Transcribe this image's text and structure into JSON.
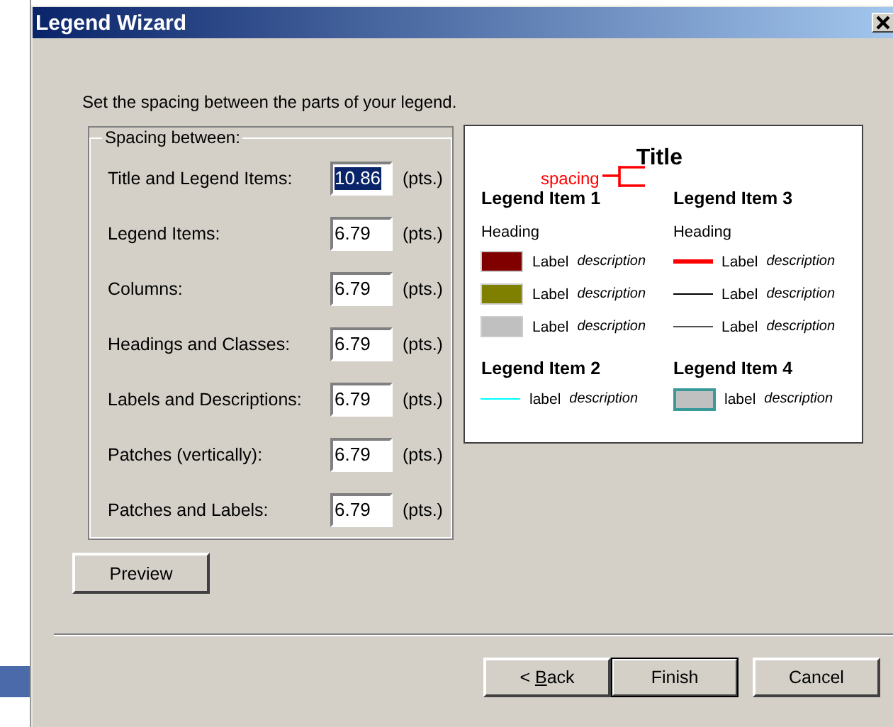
{
  "window": {
    "title": "Legend Wizard"
  },
  "instruction": "Set the spacing between the parts of your legend.",
  "spacing_group": {
    "label": "Spacing between:",
    "rows": [
      {
        "label": "Title and Legend Items:",
        "value": "10.86",
        "unit": "(pts.)",
        "selected": true
      },
      {
        "label": "Legend Items:",
        "value": "6.79",
        "unit": "(pts.)",
        "selected": false
      },
      {
        "label": "Columns:",
        "value": "6.79",
        "unit": "(pts.)",
        "selected": false
      },
      {
        "label": "Headings and Classes:",
        "value": "6.79",
        "unit": "(pts.)",
        "selected": false
      },
      {
        "label": "Labels and Descriptions:",
        "value": "6.79",
        "unit": "(pts.)",
        "selected": false
      },
      {
        "label": "Patches (vertically):",
        "value": "6.79",
        "unit": "(pts.)",
        "selected": false
      },
      {
        "label": "Patches and Labels:",
        "value": "6.79",
        "unit": "(pts.)",
        "selected": false
      }
    ]
  },
  "legend_preview": {
    "title": "Title",
    "spacing_label": "spacing",
    "columns": [
      {
        "items": [
          {
            "heading": "Legend Item 1",
            "subheading": "Heading",
            "entries": [
              {
                "kind": "patch",
                "color": "#800000",
                "label": "Label",
                "description": "description"
              },
              {
                "kind": "patch",
                "color": "#808000",
                "label": "Label",
                "description": "description"
              },
              {
                "kind": "patch",
                "color": "#c0c0c0",
                "label": "Label",
                "description": "description"
              }
            ]
          },
          {
            "heading": "Legend Item 2",
            "entries": [
              {
                "kind": "line",
                "color": "#00ffff",
                "label": "label",
                "description": "description"
              }
            ]
          }
        ]
      },
      {
        "items": [
          {
            "heading": "Legend Item 3",
            "subheading": "Heading",
            "entries": [
              {
                "kind": "thick-line",
                "color": "#ff0000",
                "label": "Label",
                "description": "description"
              },
              {
                "kind": "line",
                "color": "#000000",
                "label": "Label",
                "description": "description"
              },
              {
                "kind": "line",
                "color": "#505050",
                "label": "Label",
                "description": "description"
              }
            ]
          },
          {
            "heading": "Legend Item 4",
            "entries": [
              {
                "kind": "outlined-patch",
                "color": "#c0c0c0",
                "label": "label",
                "description": "description"
              }
            ]
          }
        ]
      }
    ]
  },
  "preview_button": "Preview",
  "buttons": [
    {
      "before": "< ",
      "access_key": "B",
      "after": "ack",
      "default": false
    },
    {
      "before": "Finish",
      "default": true
    },
    {
      "before": "Cancel",
      "default": false
    }
  ]
}
